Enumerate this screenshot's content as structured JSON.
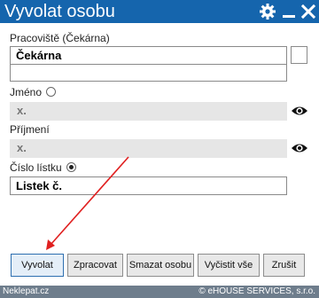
{
  "window": {
    "title": "Vyvolat osobu"
  },
  "workplace": {
    "label": "Pracoviště (Čekárna)",
    "value": "Čekárna"
  },
  "first_name": {
    "label": "Jméno",
    "value": "x."
  },
  "last_name": {
    "label": "Příjmení",
    "value": "x."
  },
  "ticket_number": {
    "label": "Číslo lístku",
    "value": "Listek č."
  },
  "buttons": {
    "call": "Vyvolat",
    "process": "Zpracovat",
    "delete": "Smazat osobu",
    "clear": "Vyčistit vše",
    "cancel": "Zrušit"
  },
  "footer": {
    "left": "Neklepat.cz",
    "right": "© eHOUSE SERVICES, s.r.o."
  },
  "colors": {
    "titlebar": "#1565ad",
    "annotation_arrow": "#e02020",
    "footer": "#6e7d8c"
  }
}
